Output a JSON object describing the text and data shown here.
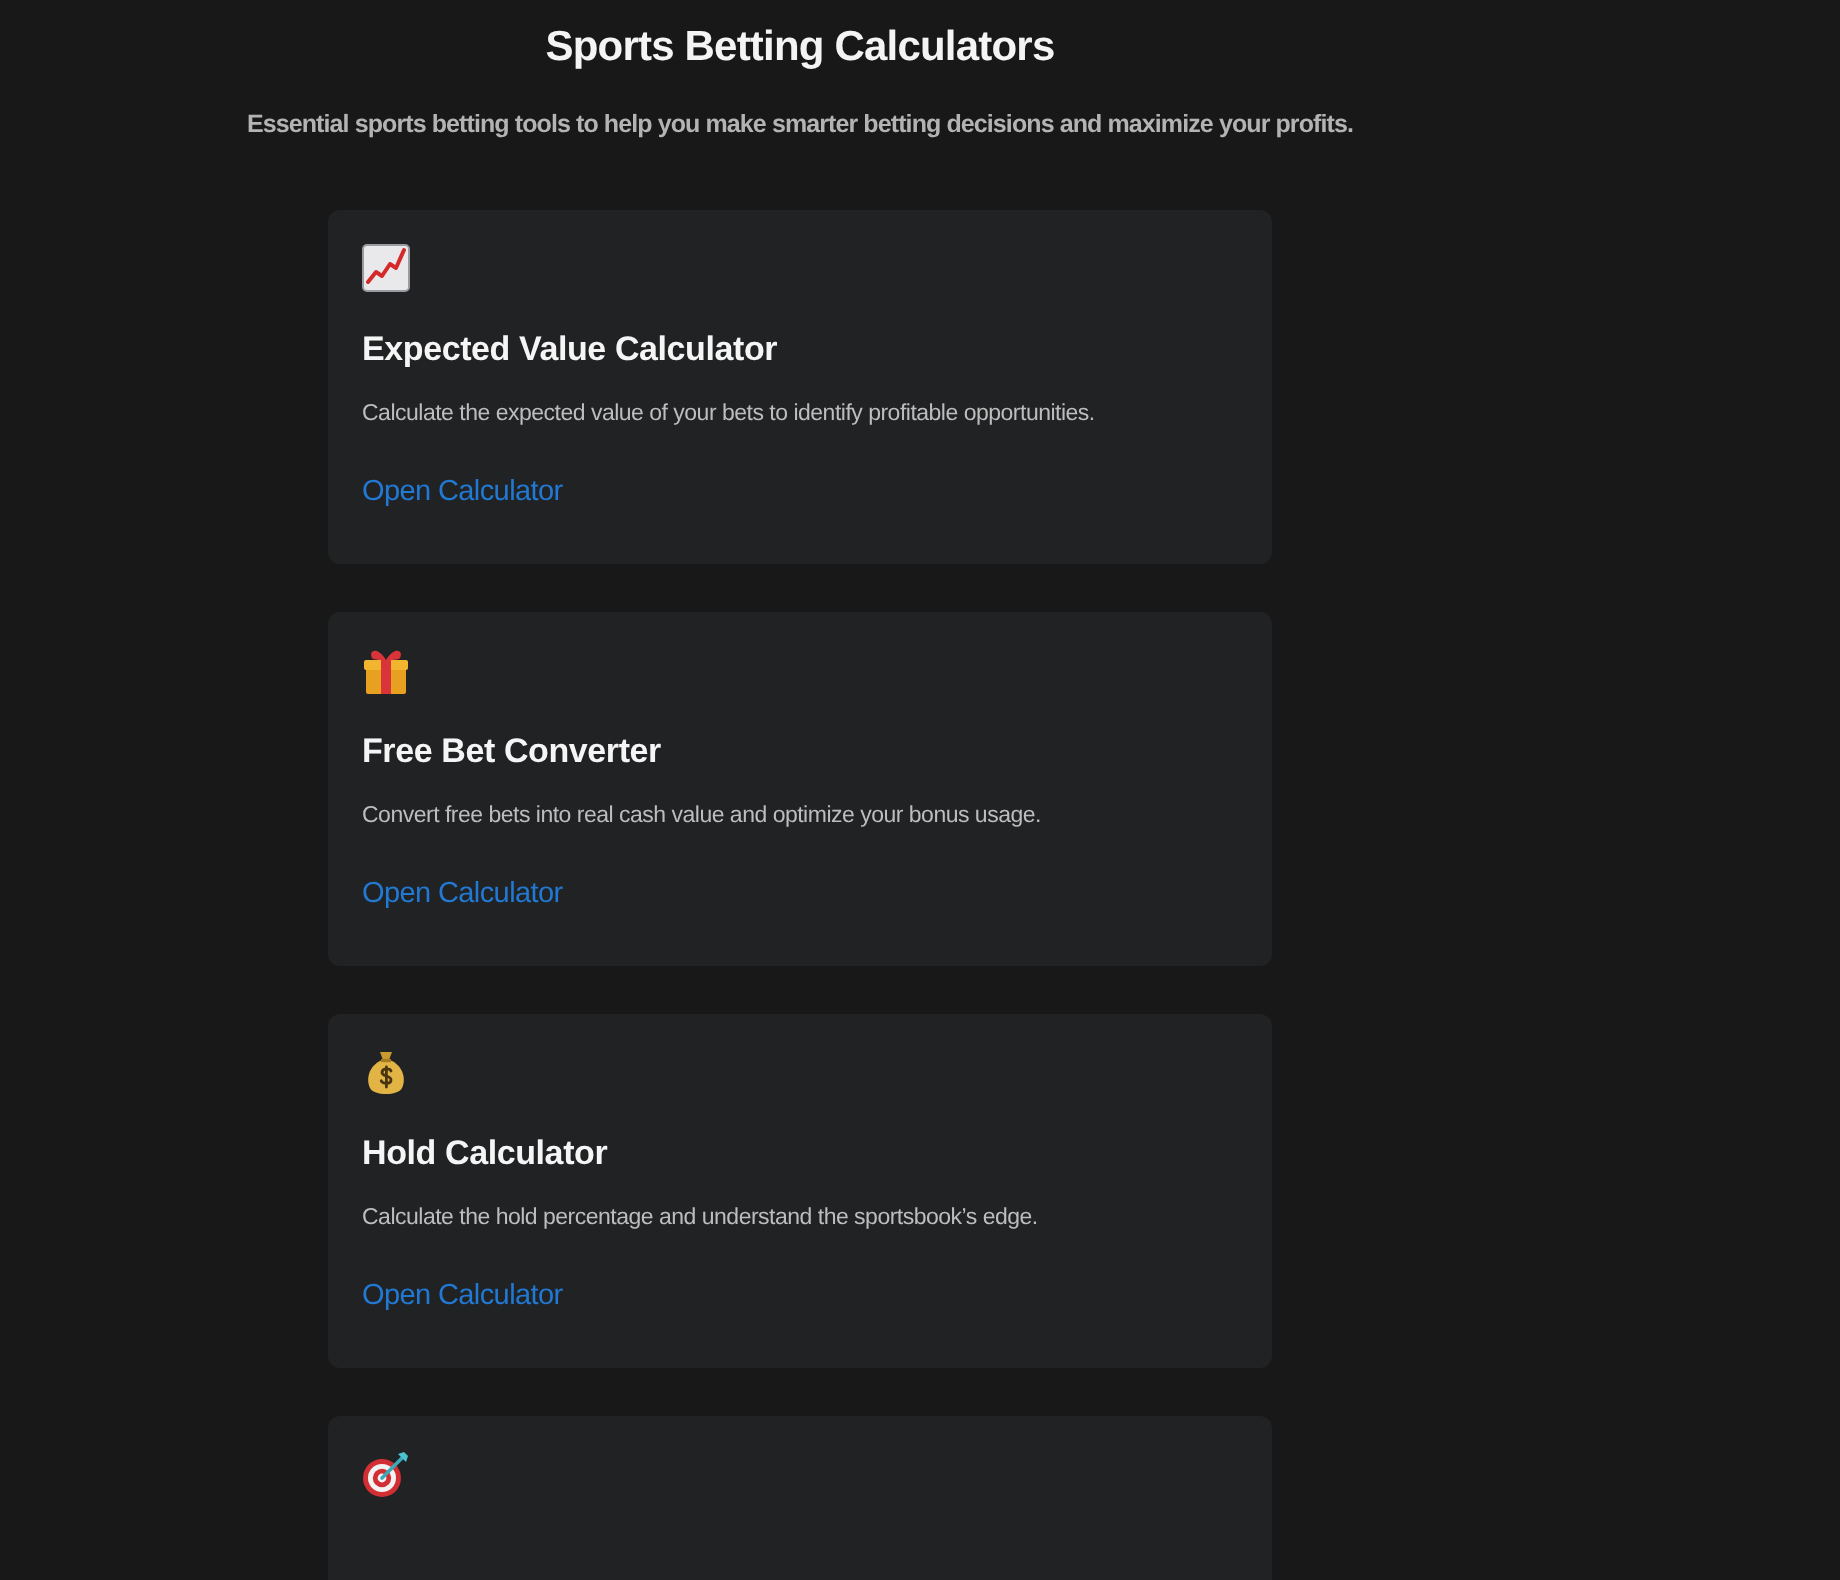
{
  "page": {
    "title": "Sports Betting Calculators",
    "subtitle": "Essential sports betting tools to help you make smarter betting decisions and maximize your profits."
  },
  "cards": [
    {
      "kind": "chart",
      "title": "Expected Value Calculator",
      "description": "Calculate the expected value of your bets to identify profitable opportunities.",
      "link": "Open Calculator"
    },
    {
      "kind": "gift",
      "title": "Free Bet Converter",
      "description": "Convert free bets into real cash value and optimize your bonus usage.",
      "link": "Open Calculator"
    },
    {
      "kind": "money-bag",
      "title": "Hold Calculator",
      "description": "Calculate the hold percentage and understand the sportsbook’s edge.",
      "link": "Open Calculator"
    },
    {
      "kind": "target"
    }
  ]
}
